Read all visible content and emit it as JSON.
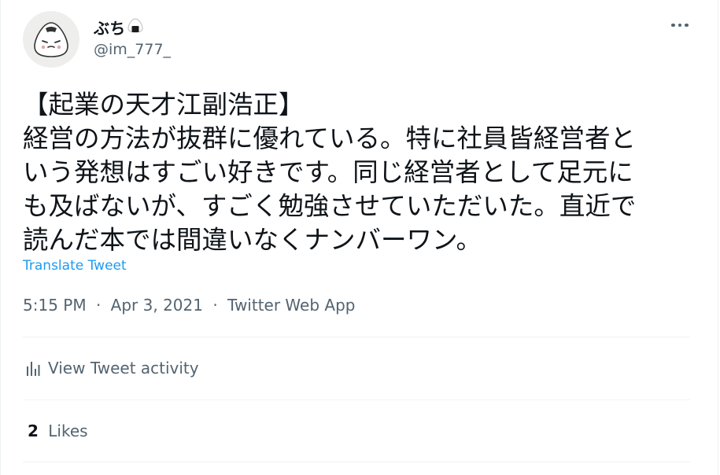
{
  "tweet": {
    "display_name": "ぶち",
    "name_emoji": "rice-ball-icon",
    "handle": "@im_777_",
    "text_lines": [
      "【起業の天才江副浩正】",
      "経営の方法が抜群に優れている。特に社員皆経営者と",
      "いう発想はすごい好きです。同じ経営者として足元に",
      "も及ばないが、すごく勉強させていただいた。直近で",
      "読んだ本では間違いなくナンバーワン。"
    ],
    "translate_label": "Translate Tweet",
    "time": "5:15 PM",
    "date": "Apr 3, 2021",
    "source": "Twitter Web App",
    "separator": "·",
    "activity_label": "View Tweet activity",
    "likes_count": "2",
    "likes_label": "Likes"
  },
  "colors": {
    "primary_text": "#0f1419",
    "secondary_text": "#536471",
    "link": "#1d9bf0",
    "divider": "#eff3f4"
  }
}
